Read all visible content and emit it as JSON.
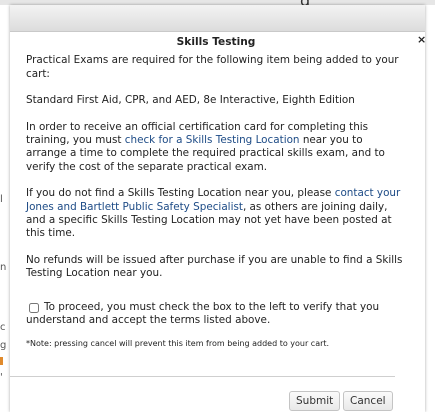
{
  "background": {
    "topbar_text": "g",
    "edge_glyphs": [
      "l",
      "n",
      "c",
      "g",
      "'"
    ]
  },
  "dialog": {
    "close_label": "×",
    "title": "Skills Testing",
    "intro": "Practical Exams are required for the following item being added to your cart:",
    "item_name": "Standard First Aid, CPR, and AED, 8e Interactive, Eighth Edition",
    "para1_before": "In order to receive an official certification card for completing this training, you must ",
    "para1_link": "check for a Skills Testing Location",
    "para1_after": " near you to arrange a time to complete the required practical skills exam, and to verify the cost of the separate practical exam.",
    "para2_before": "If you do not find a Skills Testing Location near you, please ",
    "para2_link": "contact your Jones and Bartlett Public Safety Specialist",
    "para2_after": ", as others are joining daily, and a specific Skills Testing Location may not yet have been posted at this time.",
    "refund_notice": "No refunds will be issued after purchase if you are unable to find a Skills Testing Location near you.",
    "agree_label": "To proceed, you must check the box to the left to verify that you understand and accept the terms listed above.",
    "agree_checked": false,
    "note": "*Note: pressing cancel will prevent this item from being added to your cart.",
    "submit_label": "Submit",
    "cancel_label": "Cancel"
  }
}
